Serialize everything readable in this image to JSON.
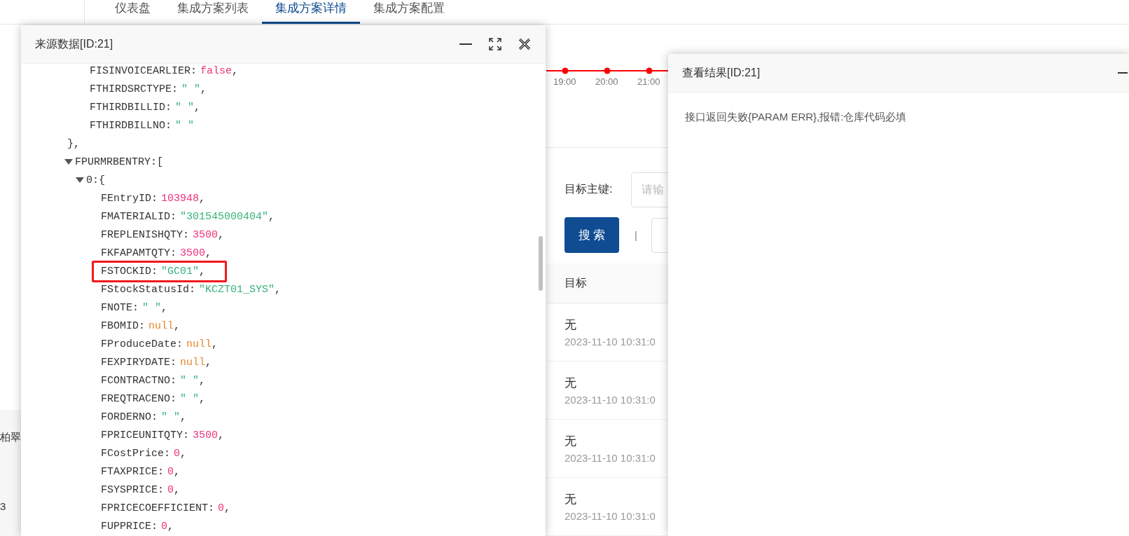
{
  "nav_tabs": [
    {
      "label": "仪表盘",
      "selected": false
    },
    {
      "label": "集成方案列表",
      "selected": false
    },
    {
      "label": "集成方案详情",
      "selected": true
    },
    {
      "label": "集成方案配置",
      "selected": false
    }
  ],
  "side_panel": {
    "title": "柏翠",
    "count": "3"
  },
  "timeline": {
    "labels": [
      "19:00",
      "20:00",
      "21:00"
    ]
  },
  "search_form": {
    "target_key_label": "目标主键:",
    "target_key_placeholder": "请输",
    "search_button": "搜 索",
    "separator": "|"
  },
  "table": {
    "columns": [
      "目标"
    ],
    "rows": [
      {
        "target": "无",
        "time": "2023-11-10 10:31:0"
      },
      {
        "target": "无",
        "time": "2023-11-10 10:31:0"
      },
      {
        "target": "无",
        "time": "2023-11-10 10:31:0"
      },
      {
        "target": "无",
        "time": "2023-11-10 10:31:0"
      }
    ]
  },
  "source_dialog": {
    "title": "来源数据[ID:21]",
    "tree": [
      {
        "close": "},",
        "children": [
          {
            "key": "FISINVOICEARLIER:",
            "value": "false",
            "color": "#f0327a",
            "punct": ",",
            "highlighted": false
          },
          {
            "key": "FTHIRDSRCTYPE:",
            "value": "\" \"",
            "color": "#38b27c",
            "punct": ",",
            "highlighted": false
          },
          {
            "key": "FTHIRDBILLID:",
            "value": "\" \"",
            "color": "#38b27c",
            "punct": ",",
            "highlighted": false
          },
          {
            "key": "FTHIRDBILLNO:",
            "value": "\" \"",
            "color": "#38b27c",
            "highlighted": false
          }
        ]
      },
      {
        "key": "FPURMRBENTRY:",
        "open": "[",
        "expanded": true,
        "children": [
          {
            "key": "0:",
            "open": "{",
            "expanded": true,
            "children": [
              {
                "key": "FEntryID:",
                "value": "103948",
                "color": "#f0327a",
                "punct": ",",
                "highlighted": false
              },
              {
                "key": "FMATERIALID:",
                "value": "\"301545000404\"",
                "color": "#38b27c",
                "punct": ",",
                "highlighted": false
              },
              {
                "key": "FREPLENISHQTY:",
                "value": "3500",
                "color": "#f0327a",
                "punct": ",",
                "highlighted": false
              },
              {
                "key": "FKFAPAMTQTY:",
                "value": "3500",
                "color": "#f0327a",
                "punct": ",",
                "highlighted": false
              },
              {
                "key": "FSTOCKID:",
                "value": "\"GC01\"",
                "color": "#38b27c",
                "punct": ",",
                "highlighted": true
              },
              {
                "key": "FStockStatusId:",
                "value": "\"KCZT01_SYS\"",
                "color": "#38b27c",
                "punct": ",",
                "highlighted": false
              },
              {
                "key": "FNOTE:",
                "value": "\" \"",
                "color": "#38b27c",
                "punct": ",",
                "highlighted": false
              },
              {
                "key": "FBOMID:",
                "value": "null",
                "color": "#e48a2c",
                "punct": ",",
                "highlighted": false
              },
              {
                "key": "FProduceDate:",
                "value": "null",
                "color": "#e48a2c",
                "punct": ",",
                "highlighted": false
              },
              {
                "key": "FEXPIRYDATE:",
                "value": "null",
                "color": "#e48a2c",
                "punct": ",",
                "highlighted": false
              },
              {
                "key": "FCONTRACTNO:",
                "value": "\" \"",
                "color": "#38b27c",
                "punct": ",",
                "highlighted": false
              },
              {
                "key": "FREQTRACENO:",
                "value": "\" \"",
                "color": "#38b27c",
                "punct": ",",
                "highlighted": false
              },
              {
                "key": "FORDERNO:",
                "value": "\" \"",
                "color": "#38b27c",
                "punct": ",",
                "highlighted": false
              },
              {
                "key": "FPRICEUNITQTY:",
                "value": "3500",
                "color": "#f0327a",
                "punct": ",",
                "highlighted": false
              },
              {
                "key": "FCostPrice:",
                "value": "0",
                "color": "#f0327a",
                "punct": ",",
                "highlighted": false
              },
              {
                "key": "FTAXPRICE:",
                "value": "0",
                "color": "#f0327a",
                "punct": ",",
                "highlighted": false
              },
              {
                "key": "FSYSPRICE:",
                "value": "0",
                "color": "#f0327a",
                "punct": ",",
                "highlighted": false
              },
              {
                "key": "FPRICECOEFFICIENT:",
                "value": "0",
                "color": "#f0327a",
                "punct": ",",
                "highlighted": false
              },
              {
                "key": "FUPPRICE:",
                "value": "0",
                "color": "#f0327a",
                "punct": ",",
                "highlighted": false
              }
            ]
          }
        ]
      }
    ]
  },
  "result_dialog": {
    "title": "查看结果[ID:21]",
    "message": "接口返回失败{PARAM ERR},报错:仓库代码必填"
  }
}
